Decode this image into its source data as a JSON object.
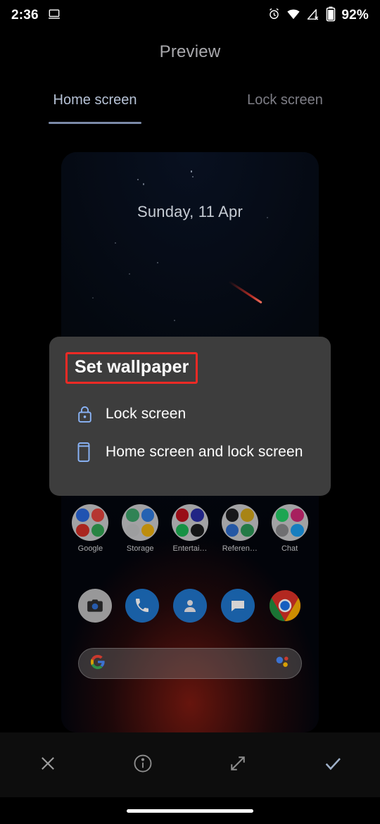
{
  "status_bar": {
    "time": "2:36",
    "battery_percent": "92%",
    "icons": [
      "laptop-cast-icon",
      "alarm-icon",
      "wifi-icon",
      "signal-off-icon",
      "battery-icon"
    ]
  },
  "header": {
    "title": "Preview"
  },
  "tabs": [
    {
      "label": "Home screen",
      "active": true
    },
    {
      "label": "Lock screen",
      "active": false
    }
  ],
  "preview": {
    "date_widget": "Sunday, 11 Apr",
    "folders": [
      {
        "label": "Google"
      },
      {
        "label": "Storage"
      },
      {
        "label": "Entertai…"
      },
      {
        "label": "Referen…"
      },
      {
        "label": "Chat"
      }
    ],
    "dock": [
      {
        "name": "camera-icon"
      },
      {
        "name": "phone-icon"
      },
      {
        "name": "contacts-icon"
      },
      {
        "name": "messages-icon"
      },
      {
        "name": "chrome-icon"
      }
    ],
    "search_bar": {
      "left_icon": "google-g-icon",
      "right_icon": "assistant-icon",
      "value": "",
      "placeholder": ""
    }
  },
  "dialog": {
    "title": "Set wallpaper",
    "highlight_color": "#ee2a25",
    "background": "#3d3d3d",
    "options": [
      {
        "icon": "lock-icon",
        "label": "Lock screen"
      },
      {
        "icon": "phone-screen-icon",
        "label": "Home screen and lock screen"
      }
    ]
  },
  "bottom_bar": {
    "buttons": [
      {
        "name": "close-button",
        "icon": "close-icon"
      },
      {
        "name": "info-button",
        "icon": "info-icon"
      },
      {
        "name": "expand-button",
        "icon": "expand-icon"
      },
      {
        "name": "confirm-button",
        "icon": "check-icon"
      }
    ],
    "confirm_color": "#9fb0c8"
  },
  "nav": {
    "pill": "gesture-nav-pill"
  }
}
